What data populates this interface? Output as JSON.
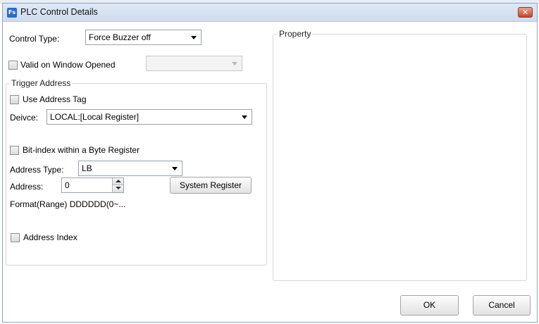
{
  "window": {
    "title": "PLC Control Details",
    "app_icon_text": "Fs",
    "close_glyph": "✕"
  },
  "control_type": {
    "label": "Control Type:",
    "value": "Force Buzzer off"
  },
  "valid_on_window_opened": {
    "label": "Valid on Window Opened",
    "checked": false,
    "dropdown_value": ""
  },
  "trigger_address": {
    "group_label": "Trigger Address",
    "use_address_tag_label": "Use Address Tag",
    "device_label": "Deivce:",
    "device_value": "LOCAL:[Local Register]",
    "bit_index_label": "Bit-index within a Byte Register",
    "address_type_label": "Address Type:",
    "address_type_value": "LB",
    "address_label": "Address:",
    "address_value": "0",
    "system_register_label": "System Register",
    "format_text": "Format(Range) DDDDDD(0~...",
    "address_index_label": "Address Index"
  },
  "property": {
    "group_label": "Property"
  },
  "footer": {
    "ok_label": "OK",
    "cancel_label": "Cancel"
  },
  "colors": {
    "title_bar": "#cfdcee",
    "close_button": "#c7452b",
    "border": "#d6d6d6"
  }
}
